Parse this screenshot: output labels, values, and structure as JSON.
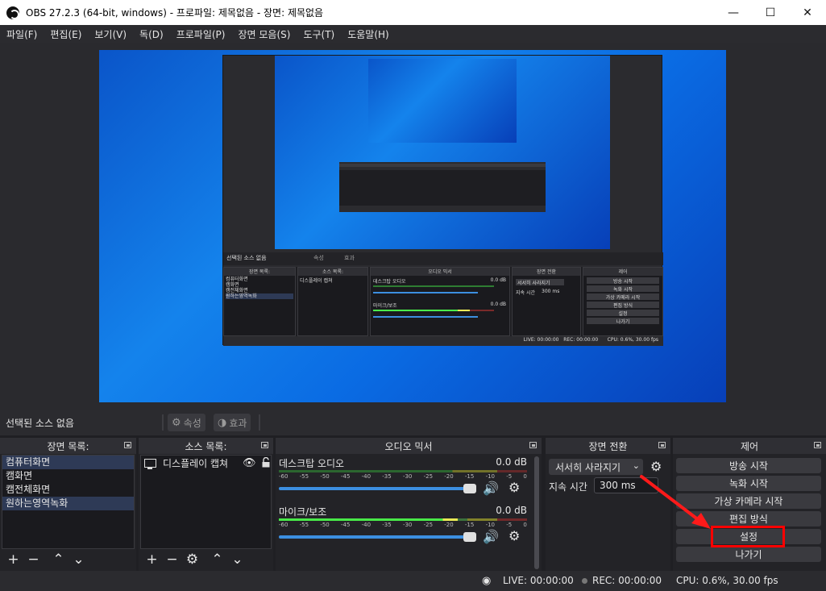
{
  "window": {
    "title": "OBS 27.2.3 (64-bit, windows) - 프로파일: 제목없음 - 장면: 제목없음",
    "minimize": "—",
    "maximize": "☐",
    "close": "✕"
  },
  "menu": [
    "파일(F)",
    "편집(E)",
    "보기(V)",
    "독(D)",
    "프로파일(P)",
    "장면 모음(S)",
    "도구(T)",
    "도움말(H)"
  ],
  "source_bar": {
    "no_source": "선택된 소스 없음",
    "properties": "속성",
    "filters": "효과"
  },
  "scenes": {
    "title": "장면 목록:",
    "items": [
      "컴퓨터화면",
      "캠화면",
      "캠전체화면",
      "원하는영역녹화"
    ],
    "selected_index": 3
  },
  "sources": {
    "title": "소스 목록:",
    "items": [
      "디스플레이 캡쳐"
    ]
  },
  "mixer": {
    "title": "오디오 믹서",
    "channels": [
      {
        "name": "데스크탑 오디오",
        "db": "0.0 dB",
        "volume_fraction": 0.97,
        "active": false
      },
      {
        "name": "마이크/보조",
        "db": "0.0 dB",
        "volume_fraction": 0.97,
        "active": true
      }
    ],
    "ticks": [
      "-60",
      "-55",
      "-50",
      "-45",
      "-40",
      "-35",
      "-30",
      "-25",
      "-20",
      "-15",
      "-10",
      "-5",
      "0"
    ]
  },
  "transitions": {
    "title": "장면 전환",
    "type": "서서히 사라지기",
    "duration_label": "지속 시간",
    "duration_value": "300 ms"
  },
  "controls": {
    "title": "제어",
    "buttons": [
      "방송 시작",
      "녹화 시작",
      "가상 카메라 시작",
      "편집 방식",
      "설정",
      "나가기"
    ],
    "highlighted": "설정"
  },
  "status": {
    "live": "LIVE: 00:00:00",
    "rec": "REC: 00:00:00",
    "cpu": "CPU: 0.6%, 30.00 fps"
  },
  "nested_preview": {
    "no_source": "선택된 소스 없음",
    "properties": "속성",
    "filters": "효과",
    "scenes_title": "장면 목록:",
    "sources_title": "소스 목록:",
    "mixer_title": "오디오 믹서",
    "transitions_title": "장면 전환",
    "controls_title": "제어",
    "desktop_audio": "데스크탑 오디오",
    "mic": "마이크/보조",
    "db": "0.0 dB",
    "status": "LIVE: 00:00:00   REC: 00:00:00      CPU: 0.6%, 30.00 fps"
  },
  "colors": {
    "accent": "#3c8fe0",
    "highlight": "#ff0000",
    "background": "#1f1f23"
  }
}
